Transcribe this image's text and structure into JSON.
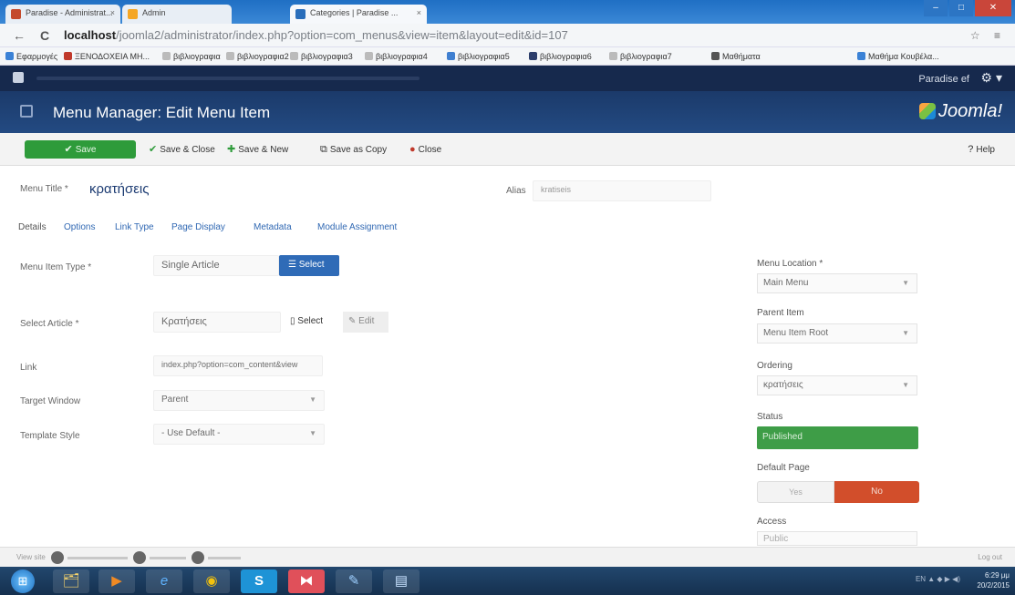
{
  "browser": {
    "tabs": [
      {
        "label": "Paradise - Administrat...",
        "color": "#c44a2c"
      },
      {
        "label": "Admin",
        "color": "#f5a623"
      },
      {
        "label": "Categories | Paradise ...",
        "color": "#2a6ebb"
      }
    ],
    "tab_close": "×",
    "url_host": "localhost",
    "url_path": "/joomla2/administrator/index.php?option=com_menus&view=item&layout=edit&id=107",
    "url_prefix": "",
    "nav_back": "←",
    "nav_forward": "→",
    "nav_reload": "C",
    "addr_icons": "☆ ≡",
    "window_controls": {
      "min": "–",
      "max": "□",
      "close": "✕"
    }
  },
  "bookmarks": [
    {
      "label": "Εφαρμογές",
      "color": "#3b82d6"
    },
    {
      "label": "ΞΕΝΟΔΟΧΕΙΑ ΜΗ...",
      "color": "#c0392b"
    },
    {
      "label": "βιβλιογραφια",
      "color": "#999"
    },
    {
      "label": "βιβλιογραφια2",
      "color": "#999"
    },
    {
      "label": "βιβλιογραφια3",
      "color": "#999"
    },
    {
      "label": "βιβλιογραφια4",
      "color": "#999"
    },
    {
      "label": "βιβλιογραφια5",
      "color": "#3f7fd0"
    },
    {
      "label": "βιβλιογραφια6",
      "color": "#2c3e6b"
    },
    {
      "label": "βιβλιογραφια7",
      "color": "#999"
    },
    {
      "label": "Μαθήματα",
      "color": "#555"
    },
    {
      "label": "Μαθήμα Κουβέλα...",
      "color": "#3b82d6"
    }
  ],
  "admin": {
    "user": "Paradise ef",
    "gear": "⚙ ▾",
    "page_title": "Menu Manager: Edit Menu Item",
    "brand": "Joomla!"
  },
  "toolbar": {
    "save": "Save",
    "save_close": "Save & Close",
    "save_new": "Save & New",
    "save_copy": "Save as Copy",
    "close": "Close",
    "help": "Help",
    "icons": {
      "save": "✔",
      "save_close": "✔",
      "save_new": "✚",
      "save_copy": "⧉",
      "close": "●",
      "help": "?"
    }
  },
  "form": {
    "menu_title_label": "Menu Title *",
    "menu_title_value": "κρατήσεις",
    "alias_label": "Alias",
    "alias_value": "kratiseis",
    "tabs": [
      "Details",
      "Options",
      "Link Type",
      "Page Display",
      "Metadata",
      "Module Assignment"
    ],
    "menu_item_type_label": "Menu Item Type *",
    "menu_item_type_value": "Single Article",
    "select_button": "Select",
    "select_article_label": "Select Article *",
    "select_article_value": "Κρατήσεις",
    "select_label": "Select",
    "edit_label": "Edit",
    "link_label": "Link",
    "link_value": "index.php?option=com_content&view",
    "target_window_label": "Target Window",
    "target_window_value": "Parent",
    "template_style_label": "Template Style",
    "template_style_value": "- Use Default -"
  },
  "sidebar": {
    "menu_location_label": "Menu Location *",
    "menu_location_value": "Main Menu",
    "parent_item_label": "Parent Item",
    "parent_item_value": "Menu Item Root",
    "ordering_label": "Ordering",
    "ordering_value": "κρατήσεις",
    "status_label": "Status",
    "status_value": "Published",
    "default_page_label": "Default Page",
    "yes": "Yes",
    "no": "No",
    "access_label": "Access",
    "access_value": "Public"
  },
  "statusbar": {
    "left": "View site",
    "right": "Log out"
  },
  "taskbar": {
    "start": "⊞",
    "apps": [
      "🗂",
      "▶",
      "e",
      "◉",
      "S",
      "⧓",
      "✎",
      "▤"
    ],
    "tray": "EN ▲ ◆ ▶ ◀)",
    "time": "6:29 μμ",
    "date": "20/2/2015"
  }
}
